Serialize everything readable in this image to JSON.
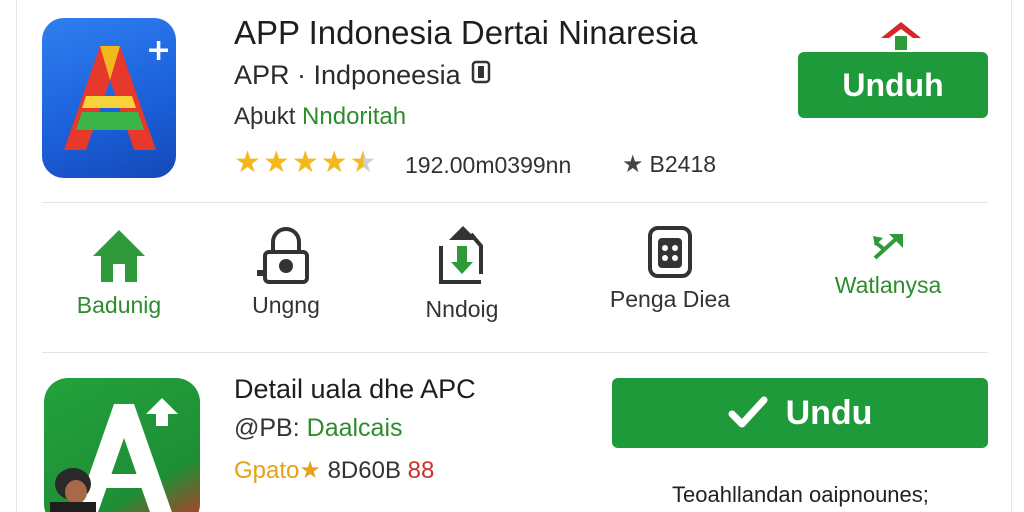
{
  "header": {
    "title": "APP Indonesia Dertai Ninaresia",
    "subtitle": "APR · Indponeesia",
    "developer_prefix": "Aþukt",
    "developer_name": "Nndoritah",
    "rating_stars": 4.5,
    "downloads": "192.00m0399nn",
    "rank": "B2418",
    "install_button": "Unduh"
  },
  "nav": {
    "items": [
      {
        "label": "Badunig",
        "icon": "home-icon",
        "color": "#2e8b2e"
      },
      {
        "label": "Ungng",
        "icon": "lock-icon",
        "color": "#333333"
      },
      {
        "label": "Nndoig",
        "icon": "download-arrow-icon",
        "color": "#333333"
      },
      {
        "label": "Penga Diea",
        "icon": "keypad-icon",
        "color": "#333333"
      },
      {
        "label": "Watlanysa",
        "icon": "share-arrows-icon",
        "color": "#2e8b2e"
      }
    ]
  },
  "section2": {
    "title": "Detail uala dhe APC",
    "meta_label": "@PB:",
    "meta_value": "Daalcais",
    "price_a": "Gpato★",
    "price_b": "8D60B",
    "price_c": "88",
    "button_label": "Undu",
    "footer_note": "Teoahllandan oaipnounes;"
  },
  "colors": {
    "primary_green": "#1f9a3a",
    "star_gold": "#f2b81c",
    "app_blue": "#1b5fd9"
  }
}
